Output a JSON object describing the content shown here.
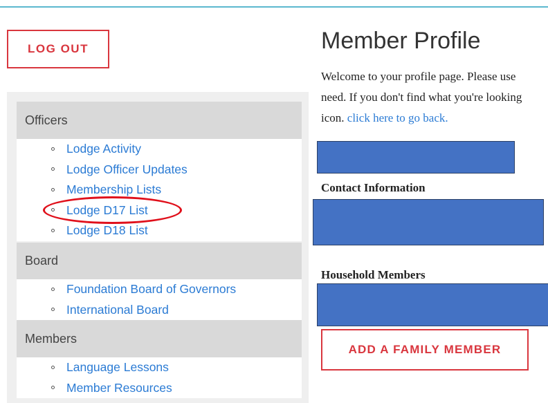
{
  "header": {
    "logout_label": "LOG OUT"
  },
  "sidebar": {
    "sections": [
      {
        "title": "Officers",
        "links": [
          "Lodge Activity",
          "Lodge Officer Updates",
          "Membership Lists",
          "Lodge D17 List",
          "Lodge D18 List"
        ]
      },
      {
        "title": "Board",
        "links": [
          "Foundation Board of Governors",
          "International Board"
        ]
      },
      {
        "title": "Members",
        "links": [
          "Language Lessons",
          "Member Resources"
        ]
      }
    ],
    "highlighted_link": "Lodge D17 List"
  },
  "main": {
    "title": "Member Profile",
    "intro_line1": "Welcome to your profile page. Please use",
    "intro_line2": "need. If you don't find what you're looking",
    "intro_line3_prefix": "icon. ",
    "intro_link": "click here to go back.",
    "contact_label": "Contact Information",
    "household_label": "Household Members",
    "add_family_label": "ADD A FAMILY MEMBER"
  },
  "colors": {
    "accent_red": "#d9363e",
    "link_blue": "#2b7bd4",
    "redaction_blue": "#4472c4",
    "top_rule": "#5bb8cf",
    "highlight_oval": "#e0101b"
  }
}
